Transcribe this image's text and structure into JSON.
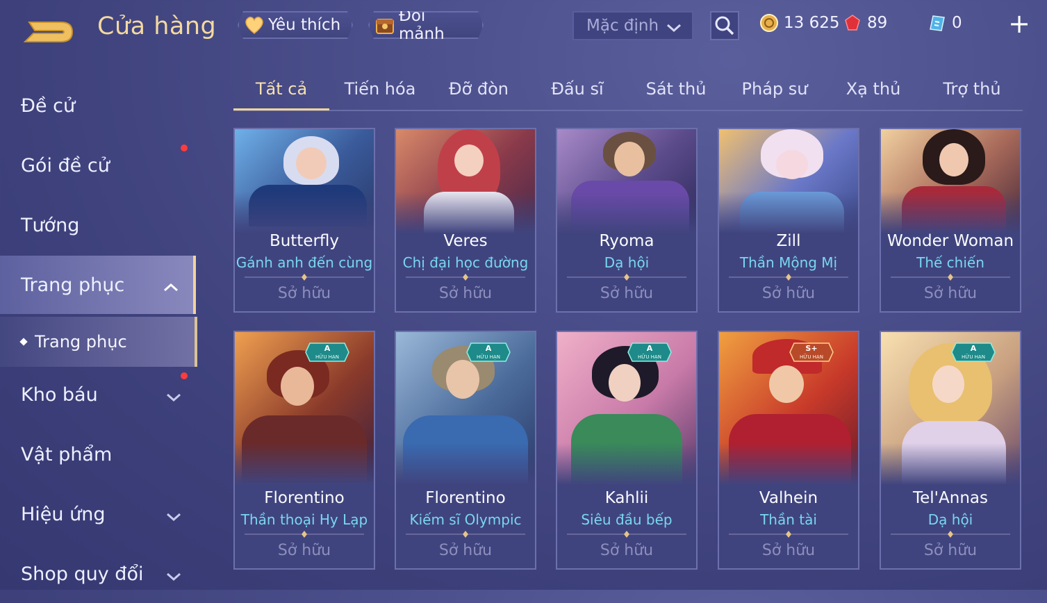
{
  "header": {
    "title": "Cửa hàng",
    "favorite_label": "Yêu thích",
    "shard_label": "Đổi mảnh",
    "sort_value": "Mặc định",
    "gold": "13 625",
    "ruby": "89",
    "voucher": "0"
  },
  "sidebar": {
    "items": [
      {
        "label": "Đề cử"
      },
      {
        "label": "Gói đề cử"
      },
      {
        "label": "Tướng"
      },
      {
        "label": "Trang phục"
      },
      {
        "label": "Trang phục"
      },
      {
        "label": "Kho báu"
      },
      {
        "label": "Vật phẩm"
      },
      {
        "label": "Hiệu ứng"
      },
      {
        "label": "Shop quy đổi"
      }
    ]
  },
  "tabs": [
    "Tất cả",
    "Tiến hóa",
    "Đỡ đòn",
    "Đấu sĩ",
    "Sát thủ",
    "Pháp sư",
    "Xạ thủ",
    "Trợ thủ"
  ],
  "cards": [
    {
      "hero": "Butterfly",
      "skin": "Gánh anh đến cùng",
      "status": "Sở hữu"
    },
    {
      "hero": "Veres",
      "skin": "Chị đại học đường",
      "status": "Sở hữu"
    },
    {
      "hero": "Ryoma",
      "skin": "Dạ hội",
      "status": "Sở hữu"
    },
    {
      "hero": "Zill",
      "skin": "Thần Mộng Mị",
      "status": "Sở hữu"
    },
    {
      "hero": "Wonder Woman",
      "skin": "Thế chiến",
      "status": "Sở hữu"
    },
    {
      "hero": "Florentino",
      "skin": "Thần thoại Hy Lạp",
      "status": "Sở hữu",
      "tier": "A",
      "tier_label": "HỮU HẠN"
    },
    {
      "hero": "Florentino",
      "skin": "Kiếm sĩ Olympic",
      "status": "Sở hữu",
      "tier": "A",
      "tier_label": "HỮU HẠN"
    },
    {
      "hero": "Kahlii",
      "skin": "Siêu đầu bếp",
      "status": "Sở hữu",
      "tier": "A",
      "tier_label": "HỮU HẠN"
    },
    {
      "hero": "Valhein",
      "skin": "Thần tài",
      "status": "Sở hữu",
      "tier": "S+",
      "tier_label": "HỮU HẠN"
    },
    {
      "hero": "Tel'Annas",
      "skin": "Dạ hội",
      "status": "Sở hữu",
      "tier": "A",
      "tier_label": "HỮU HẠN"
    }
  ],
  "colors": {
    "accent_gold": "#f1d595",
    "skin_name": "#79d7f0",
    "notification": "#ff3c3c",
    "background": "#4a4e8a"
  },
  "icons": [
    "back-icon",
    "heart-icon",
    "shard-chest-icon",
    "chevron-down-icon",
    "search-icon",
    "gold-coin-icon",
    "ruby-icon",
    "voucher-icon",
    "plus-icon",
    "chevron-up-icon"
  ]
}
